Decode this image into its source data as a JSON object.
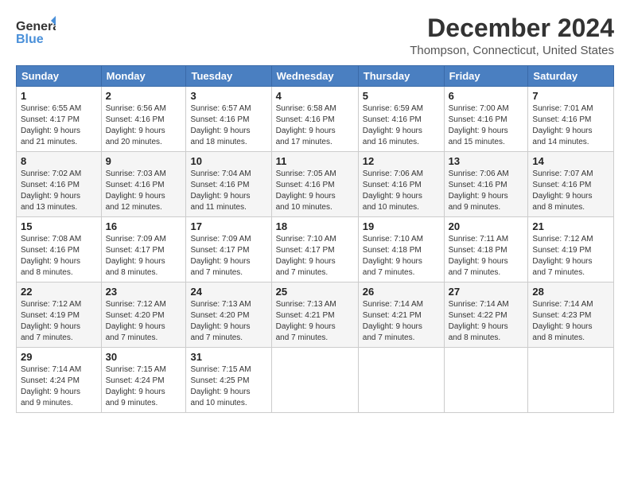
{
  "logo": {
    "general": "General",
    "blue": "Blue"
  },
  "title": {
    "month": "December 2024",
    "location": "Thompson, Connecticut, United States"
  },
  "weekdays": [
    "Sunday",
    "Monday",
    "Tuesday",
    "Wednesday",
    "Thursday",
    "Friday",
    "Saturday"
  ],
  "weeks": [
    [
      {
        "day": "1",
        "info": "Sunrise: 6:55 AM\nSunset: 4:17 PM\nDaylight: 9 hours\nand 21 minutes."
      },
      {
        "day": "2",
        "info": "Sunrise: 6:56 AM\nSunset: 4:16 PM\nDaylight: 9 hours\nand 20 minutes."
      },
      {
        "day": "3",
        "info": "Sunrise: 6:57 AM\nSunset: 4:16 PM\nDaylight: 9 hours\nand 18 minutes."
      },
      {
        "day": "4",
        "info": "Sunrise: 6:58 AM\nSunset: 4:16 PM\nDaylight: 9 hours\nand 17 minutes."
      },
      {
        "day": "5",
        "info": "Sunrise: 6:59 AM\nSunset: 4:16 PM\nDaylight: 9 hours\nand 16 minutes."
      },
      {
        "day": "6",
        "info": "Sunrise: 7:00 AM\nSunset: 4:16 PM\nDaylight: 9 hours\nand 15 minutes."
      },
      {
        "day": "7",
        "info": "Sunrise: 7:01 AM\nSunset: 4:16 PM\nDaylight: 9 hours\nand 14 minutes."
      }
    ],
    [
      {
        "day": "8",
        "info": "Sunrise: 7:02 AM\nSunset: 4:16 PM\nDaylight: 9 hours\nand 13 minutes."
      },
      {
        "day": "9",
        "info": "Sunrise: 7:03 AM\nSunset: 4:16 PM\nDaylight: 9 hours\nand 12 minutes."
      },
      {
        "day": "10",
        "info": "Sunrise: 7:04 AM\nSunset: 4:16 PM\nDaylight: 9 hours\nand 11 minutes."
      },
      {
        "day": "11",
        "info": "Sunrise: 7:05 AM\nSunset: 4:16 PM\nDaylight: 9 hours\nand 10 minutes."
      },
      {
        "day": "12",
        "info": "Sunrise: 7:06 AM\nSunset: 4:16 PM\nDaylight: 9 hours\nand 10 minutes."
      },
      {
        "day": "13",
        "info": "Sunrise: 7:06 AM\nSunset: 4:16 PM\nDaylight: 9 hours\nand 9 minutes."
      },
      {
        "day": "14",
        "info": "Sunrise: 7:07 AM\nSunset: 4:16 PM\nDaylight: 9 hours\nand 8 minutes."
      }
    ],
    [
      {
        "day": "15",
        "info": "Sunrise: 7:08 AM\nSunset: 4:16 PM\nDaylight: 9 hours\nand 8 minutes."
      },
      {
        "day": "16",
        "info": "Sunrise: 7:09 AM\nSunset: 4:17 PM\nDaylight: 9 hours\nand 8 minutes."
      },
      {
        "day": "17",
        "info": "Sunrise: 7:09 AM\nSunset: 4:17 PM\nDaylight: 9 hours\nand 7 minutes."
      },
      {
        "day": "18",
        "info": "Sunrise: 7:10 AM\nSunset: 4:17 PM\nDaylight: 9 hours\nand 7 minutes."
      },
      {
        "day": "19",
        "info": "Sunrise: 7:10 AM\nSunset: 4:18 PM\nDaylight: 9 hours\nand 7 minutes."
      },
      {
        "day": "20",
        "info": "Sunrise: 7:11 AM\nSunset: 4:18 PM\nDaylight: 9 hours\nand 7 minutes."
      },
      {
        "day": "21",
        "info": "Sunrise: 7:12 AM\nSunset: 4:19 PM\nDaylight: 9 hours\nand 7 minutes."
      }
    ],
    [
      {
        "day": "22",
        "info": "Sunrise: 7:12 AM\nSunset: 4:19 PM\nDaylight: 9 hours\nand 7 minutes."
      },
      {
        "day": "23",
        "info": "Sunrise: 7:12 AM\nSunset: 4:20 PM\nDaylight: 9 hours\nand 7 minutes."
      },
      {
        "day": "24",
        "info": "Sunrise: 7:13 AM\nSunset: 4:20 PM\nDaylight: 9 hours\nand 7 minutes."
      },
      {
        "day": "25",
        "info": "Sunrise: 7:13 AM\nSunset: 4:21 PM\nDaylight: 9 hours\nand 7 minutes."
      },
      {
        "day": "26",
        "info": "Sunrise: 7:14 AM\nSunset: 4:21 PM\nDaylight: 9 hours\nand 7 minutes."
      },
      {
        "day": "27",
        "info": "Sunrise: 7:14 AM\nSunset: 4:22 PM\nDaylight: 9 hours\nand 8 minutes."
      },
      {
        "day": "28",
        "info": "Sunrise: 7:14 AM\nSunset: 4:23 PM\nDaylight: 9 hours\nand 8 minutes."
      }
    ],
    [
      {
        "day": "29",
        "info": "Sunrise: 7:14 AM\nSunset: 4:24 PM\nDaylight: 9 hours\nand 9 minutes."
      },
      {
        "day": "30",
        "info": "Sunrise: 7:15 AM\nSunset: 4:24 PM\nDaylight: 9 hours\nand 9 minutes."
      },
      {
        "day": "31",
        "info": "Sunrise: 7:15 AM\nSunset: 4:25 PM\nDaylight: 9 hours\nand 10 minutes."
      },
      {
        "day": "",
        "info": ""
      },
      {
        "day": "",
        "info": ""
      },
      {
        "day": "",
        "info": ""
      },
      {
        "day": "",
        "info": ""
      }
    ]
  ]
}
